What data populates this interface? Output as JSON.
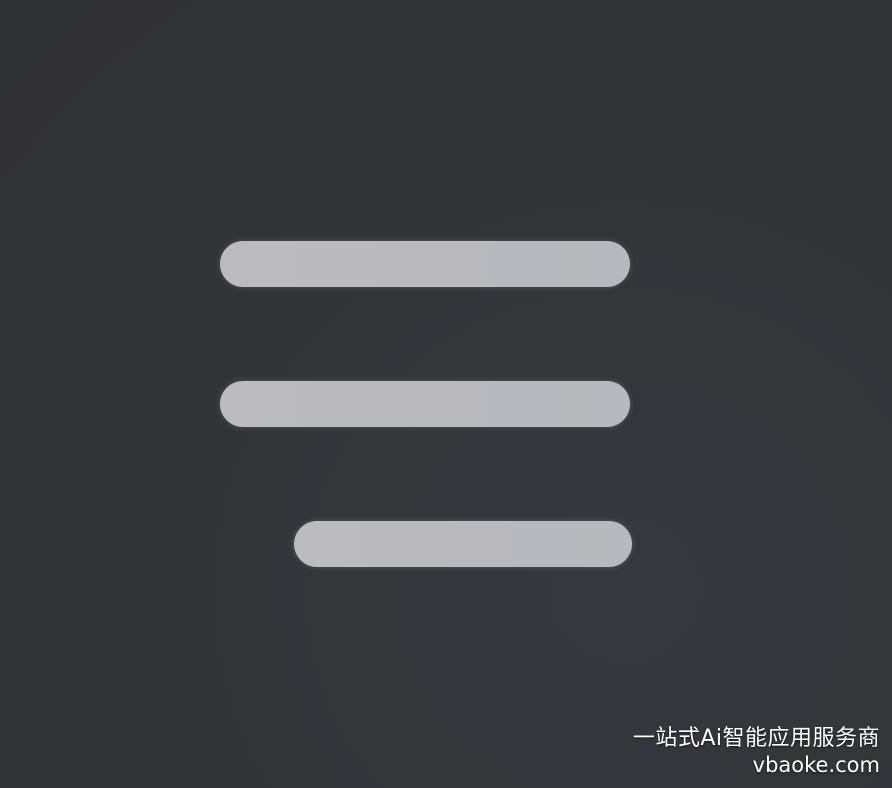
{
  "icon": {
    "name": "hamburger-menu-icon",
    "bar_color": "#bcbcc0",
    "background_color": "#333438"
  },
  "watermark": {
    "line1": "一站式Ai智能应用服务商",
    "line2": "vbaoke.com"
  }
}
